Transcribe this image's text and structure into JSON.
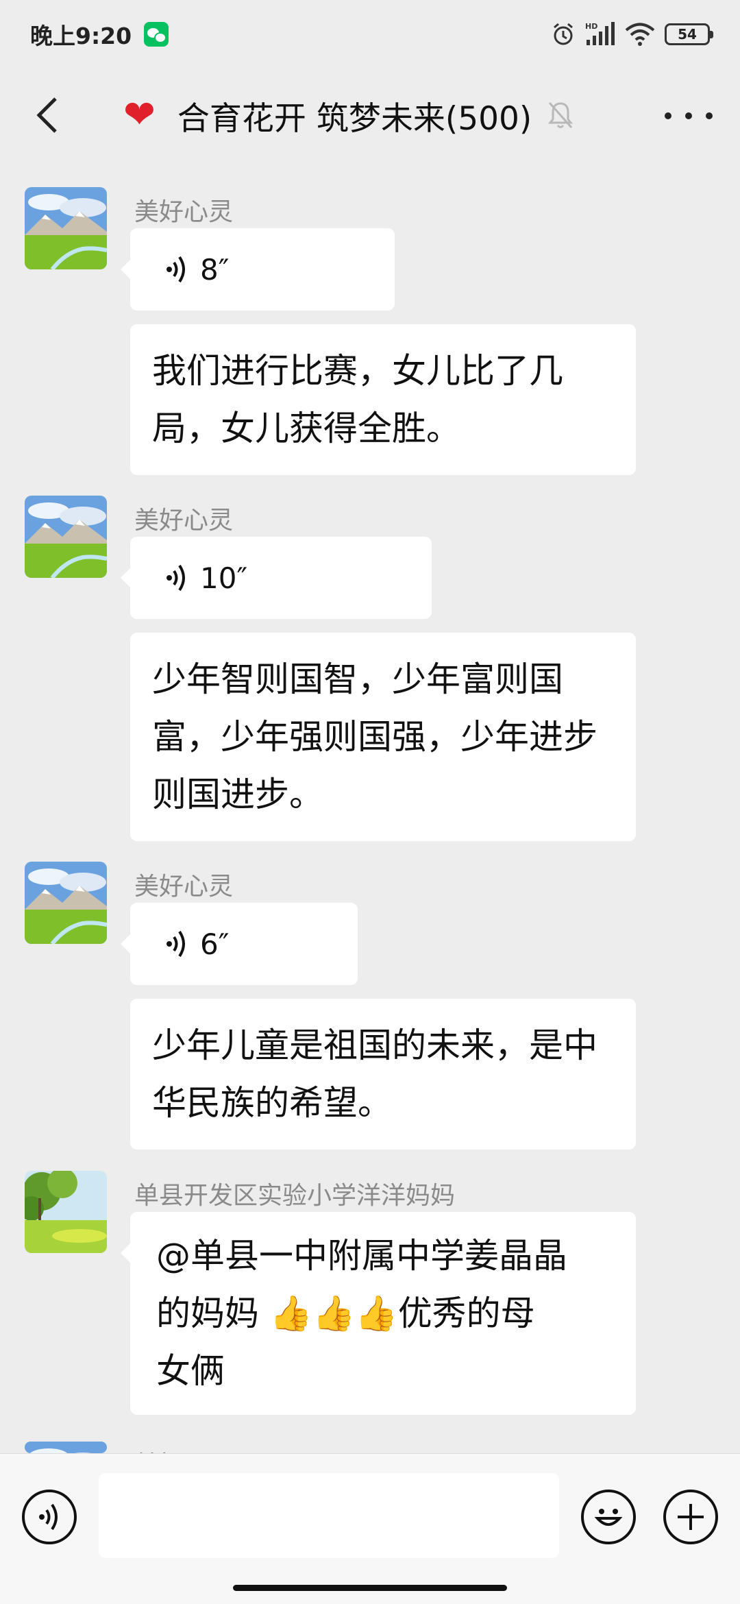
{
  "status_bar": {
    "time": "晚上9:20",
    "network_label": "HD",
    "battery": "54"
  },
  "header": {
    "title": "合育花开 筑梦未来(500)",
    "heart": "❤",
    "icons": [
      "back-icon",
      "heart-icon",
      "mute-bell-icon",
      "more-icon"
    ]
  },
  "messages": [
    {
      "sender": "美好心灵",
      "voice_duration": "8″",
      "text": "我们进行比赛，女儿比了几局，女儿获得全胜。"
    },
    {
      "sender": "美好心灵",
      "voice_duration": "10″",
      "text": "少年智则国智，少年富则国富，少年强则国强，少年进步则国进步。"
    },
    {
      "sender": "美好心灵",
      "voice_duration": "6″",
      "text": "少年儿童是祖国的未来，是中华民族的希望。"
    },
    {
      "sender": "单县开发区实验小学洋洋妈妈",
      "text_line1": "@单县一中附属中学姜晶晶",
      "text_line2_a": "的妈妈 ",
      "thumbs": "👍👍👍",
      "text_line2_b": "优秀的母",
      "text_line3": "女俩"
    },
    {
      "sender": "美好心灵"
    }
  ],
  "input_bar": {
    "icons": [
      "voice-icon",
      "emoji-icon",
      "plus-icon"
    ]
  }
}
